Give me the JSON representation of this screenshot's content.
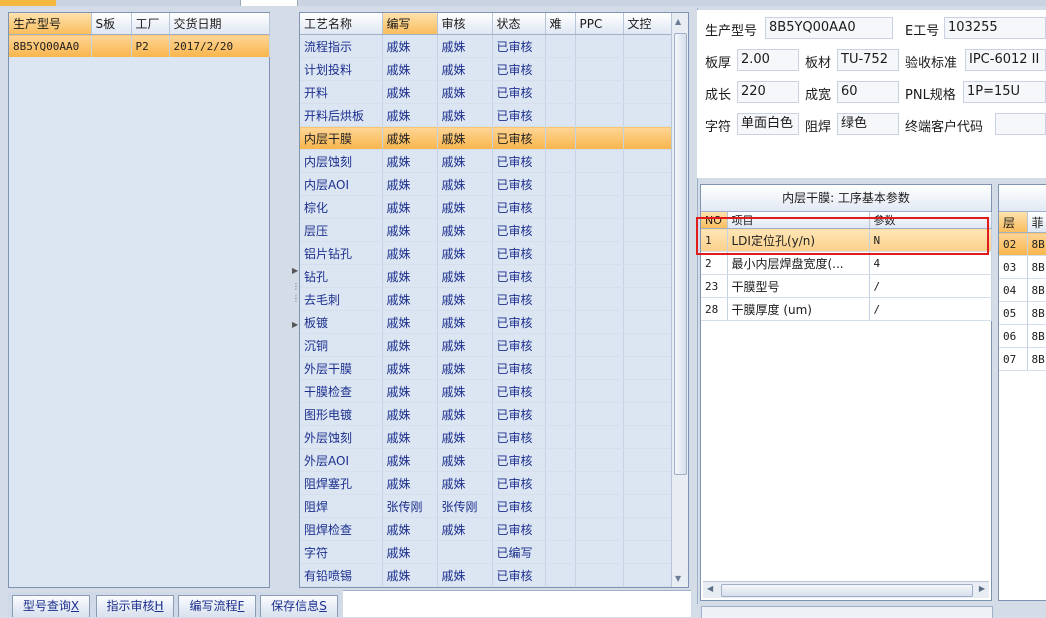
{
  "left_grid": {
    "headers": [
      "生产型号",
      "S板",
      "工厂",
      "交货日期"
    ],
    "rows": [
      [
        "8B5YQ00AA0",
        "",
        "P2",
        "2017/2/20"
      ]
    ]
  },
  "process_grid": {
    "headers": [
      "工艺名称",
      "编写",
      "审核",
      "状态",
      "难",
      "PPC",
      "文控"
    ],
    "rows": [
      [
        "流程指示",
        "戚姝",
        "戚姝",
        "已审核"
      ],
      [
        "计划投料",
        "戚姝",
        "戚姝",
        "已审核"
      ],
      [
        "开料",
        "戚姝",
        "戚姝",
        "已审核"
      ],
      [
        "开料后烘板",
        "戚姝",
        "戚姝",
        "已审核"
      ],
      [
        "内层干膜",
        "戚姝",
        "戚姝",
        "已审核"
      ],
      [
        "内层蚀刻",
        "戚姝",
        "戚姝",
        "已审核"
      ],
      [
        "内层AOI",
        "戚姝",
        "戚姝",
        "已审核"
      ],
      [
        "棕化",
        "戚姝",
        "戚姝",
        "已审核"
      ],
      [
        "层压",
        "戚姝",
        "戚姝",
        "已审核"
      ],
      [
        "铝片钻孔",
        "戚姝",
        "戚姝",
        "已审核"
      ],
      [
        "钻孔",
        "戚姝",
        "戚姝",
        "已审核"
      ],
      [
        "去毛刺",
        "戚姝",
        "戚姝",
        "已审核"
      ],
      [
        "板镀",
        "戚姝",
        "戚姝",
        "已审核"
      ],
      [
        "沉铜",
        "戚姝",
        "戚姝",
        "已审核"
      ],
      [
        "外层干膜",
        "戚姝",
        "戚姝",
        "已审核"
      ],
      [
        "干膜检查",
        "戚姝",
        "戚姝",
        "已审核"
      ],
      [
        "图形电镀",
        "戚姝",
        "戚姝",
        "已审核"
      ],
      [
        "外层蚀刻",
        "戚姝",
        "戚姝",
        "已审核"
      ],
      [
        "外层AOI",
        "戚姝",
        "戚姝",
        "已审核"
      ],
      [
        "阻焊塞孔",
        "戚姝",
        "戚姝",
        "已审核"
      ],
      [
        "阻焊",
        "张传刚",
        "张传刚",
        "已审核"
      ],
      [
        "阻焊检查",
        "戚姝",
        "戚姝",
        "已审核"
      ],
      [
        "字符",
        "戚姝",
        "",
        "已编写"
      ],
      [
        "有铅喷锡",
        "戚姝",
        "戚姝",
        "已审核"
      ]
    ],
    "selected_row": 4
  },
  "buttons": [
    {
      "text": "型号查询",
      "key": "X"
    },
    {
      "text": "指示审核",
      "key": "H"
    },
    {
      "text": "编写流程",
      "key": "F"
    },
    {
      "text": "保存信息",
      "key": "S"
    }
  ],
  "info": {
    "model_label": "生产型号",
    "model_value": "8B5YQ00AA0",
    "eno_label": "E工号",
    "eno_value": "103255",
    "thick_label": "板厚",
    "thick_value": "2.00",
    "material_label": "板材",
    "material_value": "TU-752",
    "std_label": "验收标准",
    "std_value": "IPC-6012 II",
    "len_label": "成长",
    "len_value": "220",
    "wid_label": "成宽",
    "wid_value": "60",
    "pnl_label": "PNL规格",
    "pnl_value": "1P=15U",
    "char_label": "字符",
    "char_value": "单面白色",
    "mask_label": "阻焊",
    "mask_value": "绿色",
    "cust_label": "终端客户代码",
    "cust_value": ""
  },
  "param_grid": {
    "title": "内层干膜: 工序基本参数",
    "headers": [
      "NO",
      "项目",
      "参数"
    ],
    "rows": [
      [
        "1",
        "LDI定位孔(y/n)",
        "N"
      ],
      [
        "2",
        "最小内层焊盘宽度(...",
        "4"
      ],
      [
        "23",
        "干膜型号",
        "/"
      ],
      [
        "28",
        "干膜厚度 (um)",
        "/"
      ]
    ]
  },
  "layer_grid": {
    "headers": [
      "层",
      "菲"
    ],
    "rows": [
      [
        "02",
        "8B"
      ],
      [
        "03",
        "8B"
      ],
      [
        "04",
        "8B"
      ],
      [
        "05",
        "8B"
      ],
      [
        "06",
        "8B"
      ],
      [
        "07",
        "8B"
      ]
    ]
  }
}
